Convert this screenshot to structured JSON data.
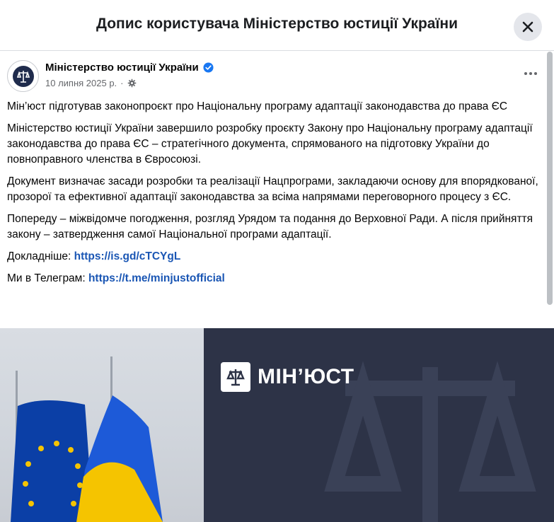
{
  "header": {
    "title": "Допис користувача Міністерство юстиції України"
  },
  "post": {
    "author": "Міністерство юстиції України",
    "date": "10 липня 2025 р.",
    "separator": "·",
    "paragraphs": [
      "Мін’юст підготував законопроєкт про Національну програму адаптації законодавства до права ЄС",
      "Міністерство юстиції України завершило розробку проєкту Закону про Національну програму адаптації законодавства до права ЄС – стратегічного документа, спрямованого на підготовку України до повноправного членства в Євросоюзі.",
      "Документ визначає засади розробки та реалізації Нацпрограми, закладаючи основу для впорядкованої, прозорої та ефективної адаптації законодавства за всіма напрямами переговорного процесу з ЄС.",
      "Попереду – міжвідомче погодження, розгляд Урядом та подання до Верховної Ради. А після прийняття закону – затвердження самої Національної програми адаптації."
    ],
    "details_label": "Докладніше:",
    "details_link": "https://is.gd/cTCYgL",
    "telegram_label": "Ми в Телеграм:",
    "telegram_link": "https://t.me/minjustofficial"
  },
  "image": {
    "brand_text": "МІН’ЮСТ"
  },
  "icons": {
    "close": "close-icon",
    "verified": "verified-badge-icon",
    "audience": "gear-icon",
    "more": "more-options-icon"
  },
  "colors": {
    "link": "#1a56b4",
    "verified": "#1877f2",
    "eu_blue": "#0b3fa6",
    "ua_yellow": "#f5c400",
    "brand_bg": "#2d3347"
  }
}
